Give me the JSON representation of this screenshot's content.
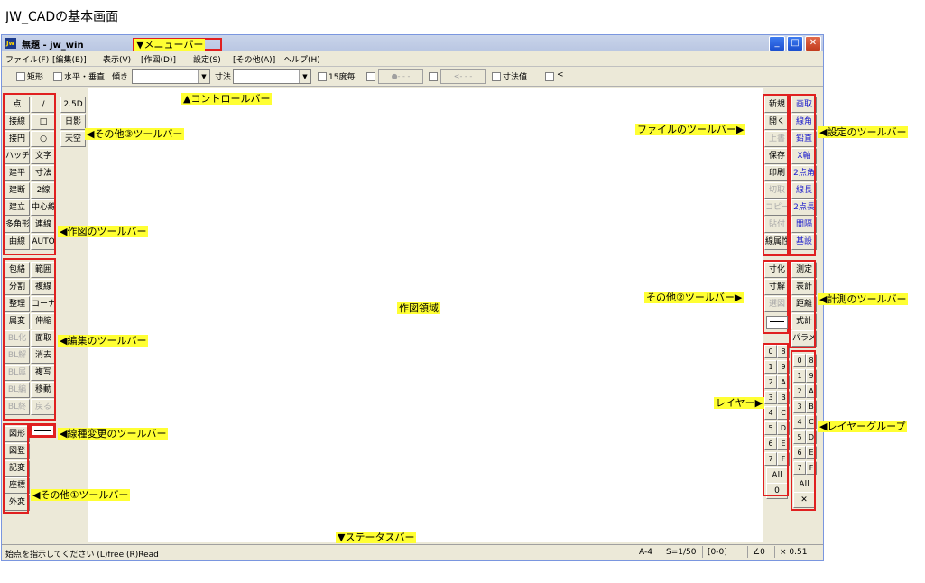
{
  "heading": "JW_CADの基本画面",
  "window": {
    "title": "無題 - jw_win",
    "icon": "jw-app-icon",
    "controls": {
      "minimize": "_",
      "maximize": "□",
      "close": "✕"
    }
  },
  "menu": [
    "ファイル(F)",
    "[編集(E)]",
    "表示(V)",
    "[作図(D)]",
    "設定(S)",
    "[その他(A)]",
    "ヘルプ(H)"
  ],
  "controlbar": {
    "rect": "矩形",
    "hv": "水平・垂直",
    "tilt": "傾き",
    "dim": "寸法",
    "deg15": "15度毎",
    "dimval": "寸法値",
    "arrow": "<",
    "dashed1": "●- - -",
    "dashed2": "<- - -"
  },
  "left_toolbar": {
    "col1": [
      "点",
      "接線",
      "接円",
      "ハッチ",
      "建平",
      "建断",
      "建立",
      "多角形",
      "曲線"
    ],
    "col2": [
      "/",
      "□",
      "○",
      "文字",
      "寸法",
      "2線",
      "中心線",
      "連線",
      "AUTO"
    ],
    "other3": [
      "2.5D",
      "日影",
      "天空"
    ],
    "edit_col1": [
      "包絡",
      "分割",
      "整理",
      "属変",
      "BL化",
      "BL解",
      "BL属",
      "BL編",
      "BL終"
    ],
    "edit_col2": [
      "範囲",
      "複線",
      "コーナー",
      "伸縮",
      "面取",
      "消去",
      "複写",
      "移動",
      "戻る"
    ],
    "other1": [
      "図形",
      "図登",
      "記変",
      "座標",
      "外変"
    ]
  },
  "right_toolbar": {
    "file": [
      "新規",
      "開く",
      "上書",
      "保存",
      "印刷",
      "切取",
      "コピー",
      "貼付",
      "線属性"
    ],
    "settings": [
      "画取",
      "線角",
      "鉛直",
      "X軸",
      "2点角",
      "線長",
      "2点長",
      "間隔",
      "基設"
    ],
    "other2": [
      "寸化",
      "寸解",
      "選図"
    ],
    "measure": [
      "測定",
      "表計",
      "距離",
      "式計",
      "パラメ"
    ],
    "layers": [
      "0",
      "8",
      "1",
      "9",
      "2",
      "A",
      "3",
      "B",
      "4",
      "C",
      "5",
      "D",
      "6",
      "E",
      "7",
      "F"
    ],
    "layer_all": "All",
    "layer_zero": "0",
    "groups": [
      "0",
      "8",
      "1",
      "9",
      "2",
      "A",
      "3",
      "B",
      "4",
      "C",
      "5",
      "D",
      "6",
      "E",
      "7",
      "F"
    ],
    "group_all": "All",
    "group_x": "✕"
  },
  "annotations": {
    "menu": "▼メニューバー",
    "control": "▲コントロールバー",
    "other3": "◀その他③ツールバー",
    "draw": "◀作図のツールバー",
    "edit": "◀編集のツールバー",
    "linetype": "◀線種変更のツールバー",
    "other1": "◀その他①ツールバー",
    "status": "▼ステータスバー",
    "area": "作図領域",
    "file": "ファイルのツールバー▶",
    "settings": "◀設定のツールバー",
    "other2": "その他②ツールバー▶",
    "measure": "◀計測のツールバー",
    "layer": "レイヤー▶",
    "group": "◀レイヤーグループ"
  },
  "status": {
    "message": "始点を指示してください (L)free (R)Read",
    "paper": "A-4",
    "scale": "S=1/50",
    "layer": "[0-0]",
    "angle": "∠0",
    "zoom": "× 0.51"
  },
  "colors": {
    "highlight": "#ffff33",
    "frame": "#e02020",
    "tool_blue": "#1d1dcc"
  }
}
